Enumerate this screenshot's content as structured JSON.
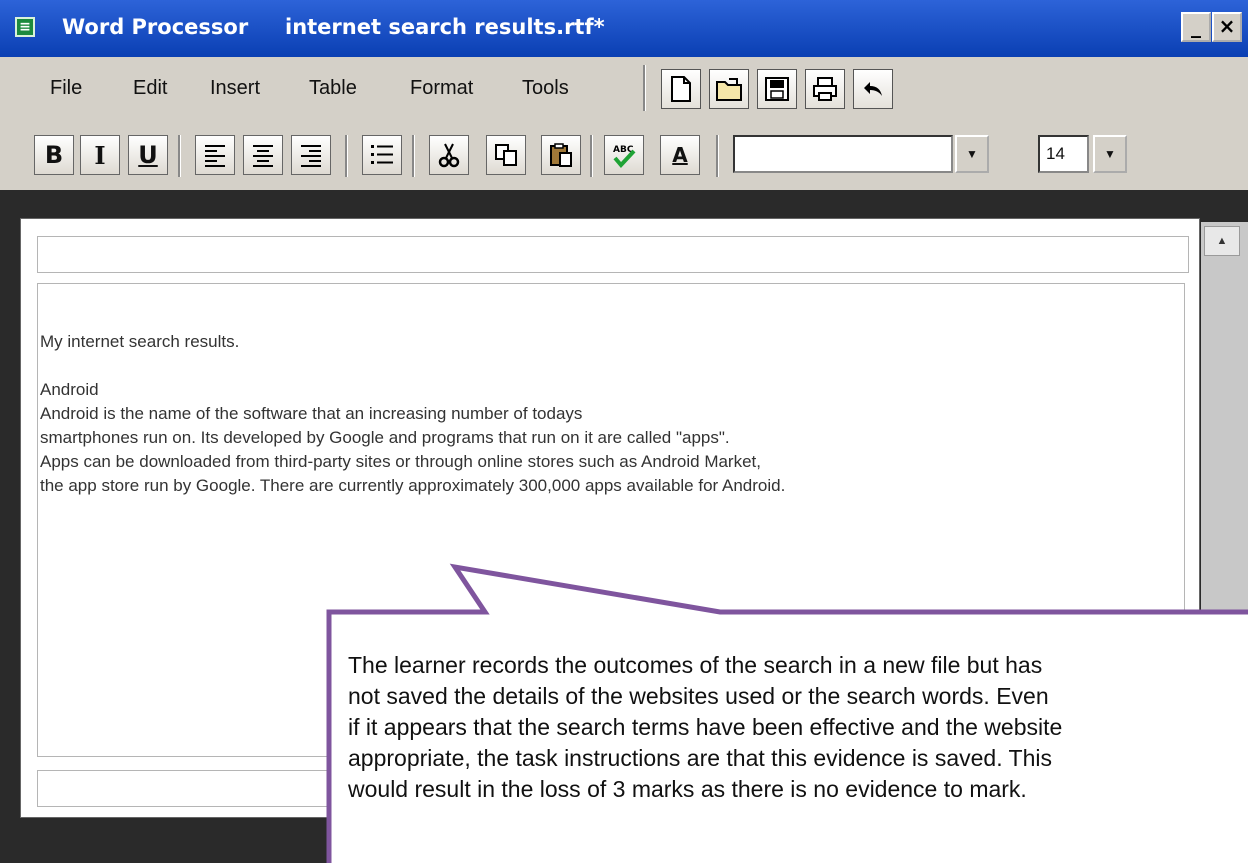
{
  "window": {
    "app_name": "Word Processor",
    "document_title": "internet search results.rtf*",
    "minimize_symbol": "_",
    "close_symbol": "×"
  },
  "menu": {
    "items": [
      "File",
      "Edit",
      "Insert",
      "Table",
      "Format",
      "Tools"
    ]
  },
  "toolbar": {
    "icons": [
      "new-document-icon",
      "open-folder-icon",
      "save-icon",
      "print-icon",
      "undo-icon"
    ]
  },
  "format_bar": {
    "bold": "B",
    "italic": "I",
    "underline": "U",
    "font_name": "",
    "font_size": "14",
    "font_color_letter": "A"
  },
  "document": {
    "lines": [
      "My internet search results.",
      "",
      "Android",
      "Android is the name of the software that an increasing number of todays",
      "smartphones run on. Its developed by Google and programs that run on it are called \"apps\".",
      "Apps can be downloaded from third-party sites or through online stores such as Android Market,",
      "the app store run by Google. There are currently approximately 300,000 apps available for Android."
    ]
  },
  "callout": {
    "lines": [
      "The learner records the outcomes of the search in a new file but has",
      "not saved the details of the websites used or the search words. Even",
      "if it appears that the search terms have been effective and the website",
      "appropriate, the task instructions are that this evidence is saved. This",
      "would result in the loss of 3 marks as there is no evidence to mark."
    ],
    "border_color": "#7f559e"
  }
}
